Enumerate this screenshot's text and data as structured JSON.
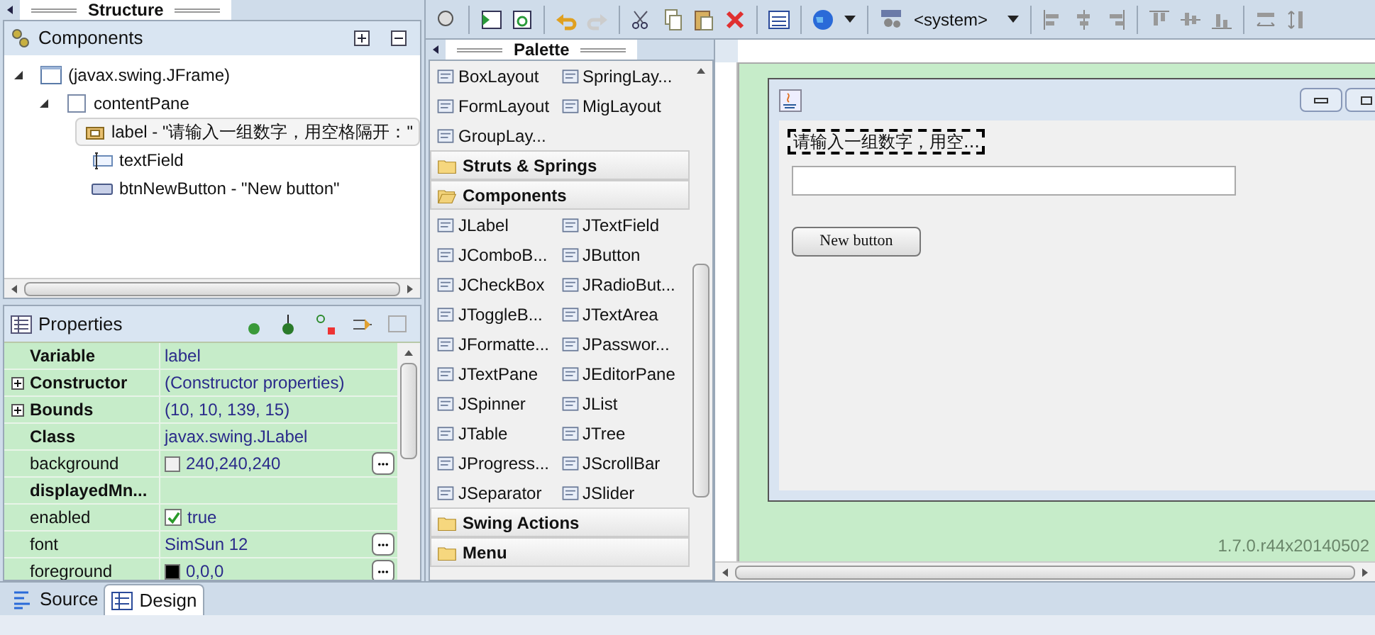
{
  "structure": {
    "title": "Structure",
    "components_title": "Components",
    "tree": [
      {
        "label": "(javax.swing.JFrame)",
        "kind": "frame",
        "expanded": true,
        "selected": false,
        "children": [
          {
            "label": "contentPane",
            "kind": "panel",
            "expanded": true,
            "selected": false,
            "children": [
              {
                "label": "label - \"请输入一组数字，用空格隔开：\"",
                "kind": "label",
                "selected": true
              },
              {
                "label": "textField",
                "kind": "textfield",
                "selected": false
              },
              {
                "label": "btnNewButton - \"New button\"",
                "kind": "button",
                "selected": false
              }
            ]
          }
        ]
      }
    ]
  },
  "properties": {
    "title": "Properties",
    "rows": [
      {
        "name": "Variable",
        "value": "label",
        "bold": true,
        "expandable": false,
        "kind": "text",
        "editor_button": false
      },
      {
        "name": "Constructor",
        "value": "(Constructor properties)",
        "bold": true,
        "expandable": true,
        "kind": "text",
        "editor_button": false
      },
      {
        "name": "Bounds",
        "value": "(10, 10, 139, 15)",
        "bold": true,
        "expandable": true,
        "kind": "text",
        "editor_button": false
      },
      {
        "name": "Class",
        "value": "javax.swing.JLabel",
        "bold": true,
        "expandable": false,
        "kind": "text",
        "editor_button": false
      },
      {
        "name": "background",
        "value": "240,240,240",
        "bold": false,
        "expandable": false,
        "kind": "color",
        "color": "#f0f0f0",
        "editor_button": true
      },
      {
        "name": "displayedMn...",
        "bold": true,
        "expandable": false,
        "kind": "text",
        "editor_button": false
      },
      {
        "name": "enabled",
        "value": "true",
        "bold": false,
        "expandable": false,
        "kind": "checkbox",
        "checked": true,
        "editor_button": false
      },
      {
        "name": "font",
        "value": "SimSun 12",
        "bold": false,
        "expandable": false,
        "kind": "text",
        "editor_button": true
      },
      {
        "name": "foreground",
        "value": "0,0,0",
        "bold": false,
        "expandable": false,
        "kind": "color",
        "color": "#000000",
        "editor_button": true
      }
    ]
  },
  "editor_tabs": [
    {
      "label": "Source",
      "selected": false
    },
    {
      "label": "Design",
      "selected": true
    }
  ],
  "toolbar": {
    "look_and_feel": "<system>"
  },
  "palette": {
    "title": "Palette",
    "sections": [
      {
        "kind": "items",
        "items": [
          "BoxLayout",
          "SpringLay...",
          "FormLayout",
          "MigLayout",
          "GroupLay..."
        ]
      },
      {
        "kind": "folder",
        "label": "Struts & Springs",
        "expanded": false
      },
      {
        "kind": "folder",
        "label": "Components",
        "expanded": true
      },
      {
        "kind": "items",
        "items": [
          "JLabel",
          "JTextField",
          "JComboB...",
          "JButton",
          "JCheckBox",
          "JRadioBut...",
          "JToggleB...",
          "JTextArea",
          "JFormatte...",
          "JPasswor...",
          "JTextPane",
          "JEditorPane",
          "JSpinner",
          "JList",
          "JTable",
          "JTree",
          "JProgress...",
          "JScrollBar",
          "JSeparator",
          "JSlider"
        ]
      },
      {
        "kind": "folder",
        "label": "Swing Actions",
        "expanded": false
      },
      {
        "kind": "folder",
        "label": "Menu",
        "expanded": false
      }
    ]
  },
  "design": {
    "label_text": "请输入一组数字，用空...",
    "label_selected": true,
    "button": "New button",
    "version": "1.7.0.r44x20140502"
  }
}
